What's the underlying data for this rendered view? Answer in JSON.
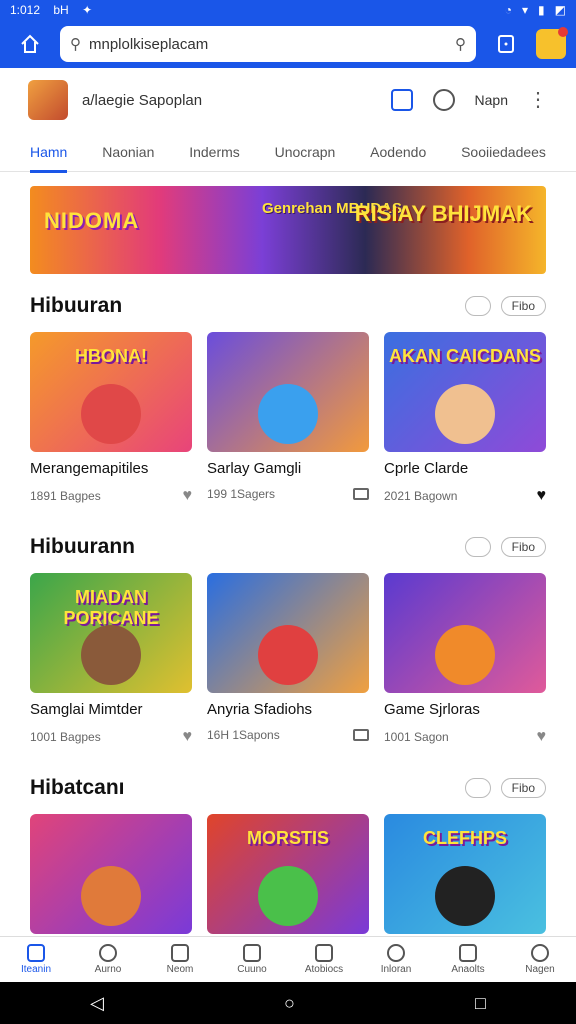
{
  "status": {
    "time": "1:012",
    "indicator": "bH",
    "arrow": "✦"
  },
  "browser": {
    "url": "mnplolkiseplacam",
    "search_icon": "search-icon",
    "home_icon": "home-icon"
  },
  "profile": {
    "name": "a/laegie Sapoplan",
    "action_label": "Napn",
    "more": "⋮"
  },
  "tabs": [
    {
      "label": "Hamn",
      "active": true
    },
    {
      "label": "Naonian"
    },
    {
      "label": "Inderms"
    },
    {
      "label": "Unocrapn"
    },
    {
      "label": "Aodendo"
    },
    {
      "label": "Sooiiedadees"
    }
  ],
  "banner": {
    "left_text": "NIDOMA",
    "mid_text": "Genrehan MBUDAS",
    "right_text": "RISIAY BHIJMAK"
  },
  "sections": [
    {
      "title": "Hibuuran",
      "pill": "Fibo",
      "cards": [
        {
          "title": "Merangemapitiles",
          "meta": "1891 Bagpes",
          "icon": "heart",
          "img_text": "HBONA!",
          "c1": "#f59a2a",
          "c2": "#e8447a",
          "char": "#e04848"
        },
        {
          "title": "Sarlay Gamgli",
          "meta": "199 1Sagers",
          "icon": "tv",
          "img_text": "",
          "c1": "#6a4ddc",
          "c2": "#f29a3c",
          "char": "#3aa0ee"
        },
        {
          "title": "Cprle Clarde",
          "meta": "2021 Bagown",
          "icon": "heart-filled",
          "img_text": "AKAN CAICDANS",
          "c1": "#3a6fe0",
          "c2": "#8f4ad8",
          "char": "#f0c090"
        }
      ]
    },
    {
      "title": "Hibuurann",
      "pill": "Fibo",
      "cards": [
        {
          "title": "Samglai Mimtder",
          "meta": "1001 Bagpes",
          "icon": "heart",
          "img_text": "MIADAN PORICANE",
          "c1": "#3ba64a",
          "c2": "#e0c030",
          "char": "#8a5a3a"
        },
        {
          "title": "Anyria Sfadiohs",
          "meta": "16H 1Sapons",
          "icon": "tv",
          "img_text": "",
          "c1": "#2a6ee0",
          "c2": "#f0a040",
          "char": "#e04040"
        },
        {
          "title": "Game Sjrloras",
          "meta": "1001 Sagon",
          "icon": "heart",
          "img_text": "",
          "c1": "#5a3ad0",
          "c2": "#e05a9a",
          "char": "#f08a2a"
        }
      ]
    },
    {
      "title": "Hibatcanı",
      "pill": "Fibo",
      "cards": [
        {
          "title": "",
          "meta": "",
          "icon": "",
          "img_text": "",
          "c1": "#e0447a",
          "c2": "#7a3ad8",
          "char": "#e07a3a"
        },
        {
          "title": "",
          "meta": "",
          "icon": "",
          "img_text": "MORSTIS",
          "c1": "#e0442a",
          "c2": "#7a3ad8",
          "char": "#4ac04a"
        },
        {
          "title": "",
          "meta": "",
          "icon": "",
          "img_text": "CLEFHPS",
          "c1": "#2a8ae0",
          "c2": "#4ac0e0",
          "char": "#222222"
        }
      ]
    }
  ],
  "bottom_nav": [
    {
      "label": "Iteanin",
      "active": true
    },
    {
      "label": "Aurno"
    },
    {
      "label": "Neom"
    },
    {
      "label": "Cuuno"
    },
    {
      "label": "Atobiocs"
    },
    {
      "label": "Inloran"
    },
    {
      "label": "Anaolts"
    },
    {
      "label": "Nagen"
    }
  ],
  "system_nav": {
    "back": "◁",
    "home": "○",
    "recents": "□"
  }
}
